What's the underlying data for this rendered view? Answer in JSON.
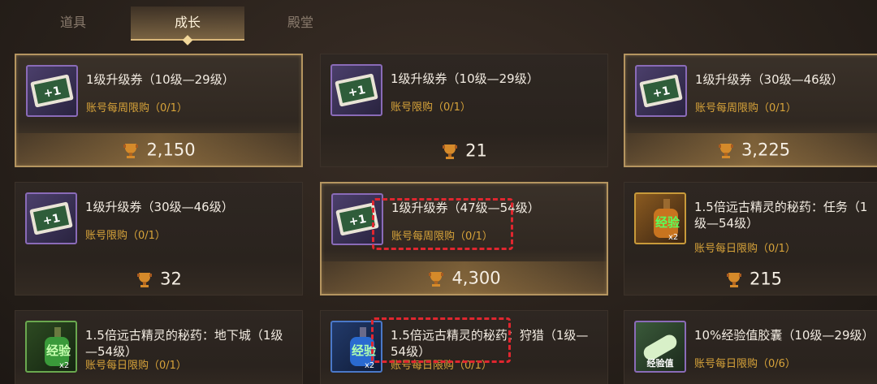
{
  "tabs": [
    {
      "label": "道具",
      "active": false
    },
    {
      "label": "成长",
      "active": true
    },
    {
      "label": "殿堂",
      "active": false
    }
  ],
  "cards": [
    {
      "title": "1级升级券（10级—29级）",
      "limit": "账号每周限购（0/1）",
      "price": "2,150",
      "icon": "upgrade-ticket-icon"
    },
    {
      "title": "1级升级券（10级—29级）",
      "limit": "账号限购（0/1）",
      "price": "21",
      "icon": "upgrade-ticket-icon"
    },
    {
      "title": "1级升级券（30级—46级）",
      "limit": "账号每周限购（0/1）",
      "price": "3,225",
      "icon": "upgrade-ticket-icon"
    },
    {
      "title": "1级升级券（30级—46级）",
      "limit": "账号限购（0/1）",
      "price": "32",
      "icon": "upgrade-ticket-icon"
    },
    {
      "title": "1级升级券（47级—54级）",
      "limit": "账号每周限购（0/1）",
      "price": "4,300",
      "icon": "upgrade-ticket-icon"
    },
    {
      "title": "1.5倍远古精灵的秘药：任务（1级—54级）",
      "limit": "账号每日限购（0/1）",
      "price": "215",
      "icon": "exp-potion-icon"
    },
    {
      "title": "1.5倍远古精灵的秘药：地下城（1级—54级）",
      "limit": "账号每日限购（0/1）",
      "price": "",
      "icon": "exp-potion-icon"
    },
    {
      "title": "1.5倍远古精灵的秘药：狩猎（1级—54级）",
      "limit": "账号每日限购（0/1）",
      "price": "",
      "icon": "exp-potion-icon"
    },
    {
      "title": "10%经验值胶囊（10级—29级）",
      "limit": "账号每日限购（0/6）",
      "price": "",
      "icon": "exp-capsule-icon"
    }
  ],
  "icon_text": {
    "ticket": "+1级",
    "potion": "经验",
    "potion_mult": "x2",
    "capsule": "经验值"
  },
  "colors": {
    "gold_border": "#b59560",
    "limit_text": "#d7a33a",
    "annotation": "#e0262f"
  }
}
